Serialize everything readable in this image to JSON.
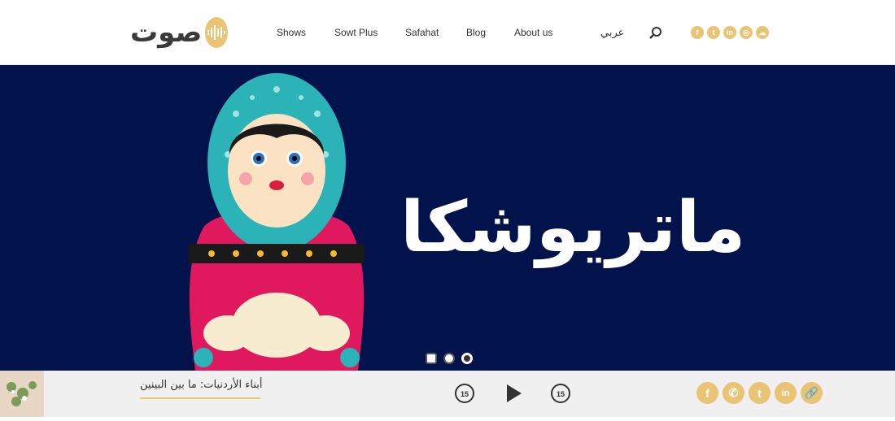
{
  "header": {
    "logo_text": "صوت",
    "nav": [
      "Shows",
      "Sowt Plus",
      "Safahat",
      "Blog",
      "About us"
    ],
    "lang_label": "عربي",
    "socials": [
      "facebook-icon",
      "twitter-icon",
      "linkedin-icon",
      "instagram-icon",
      "soundcloud-icon"
    ]
  },
  "hero": {
    "title": "ماتريوشكا",
    "slides": 3,
    "active_slide": 2
  },
  "player": {
    "track_title": "أبناء الأردنيات: ما بين البينين",
    "rewind_label": "15",
    "forward_label": "15",
    "share_icons": [
      "facebook-icon",
      "whatsapp-icon",
      "twitter-icon",
      "linkedin-icon",
      "link-icon"
    ]
  },
  "colors": {
    "accent": "#e8c474",
    "hero_bg": "#02124a"
  }
}
